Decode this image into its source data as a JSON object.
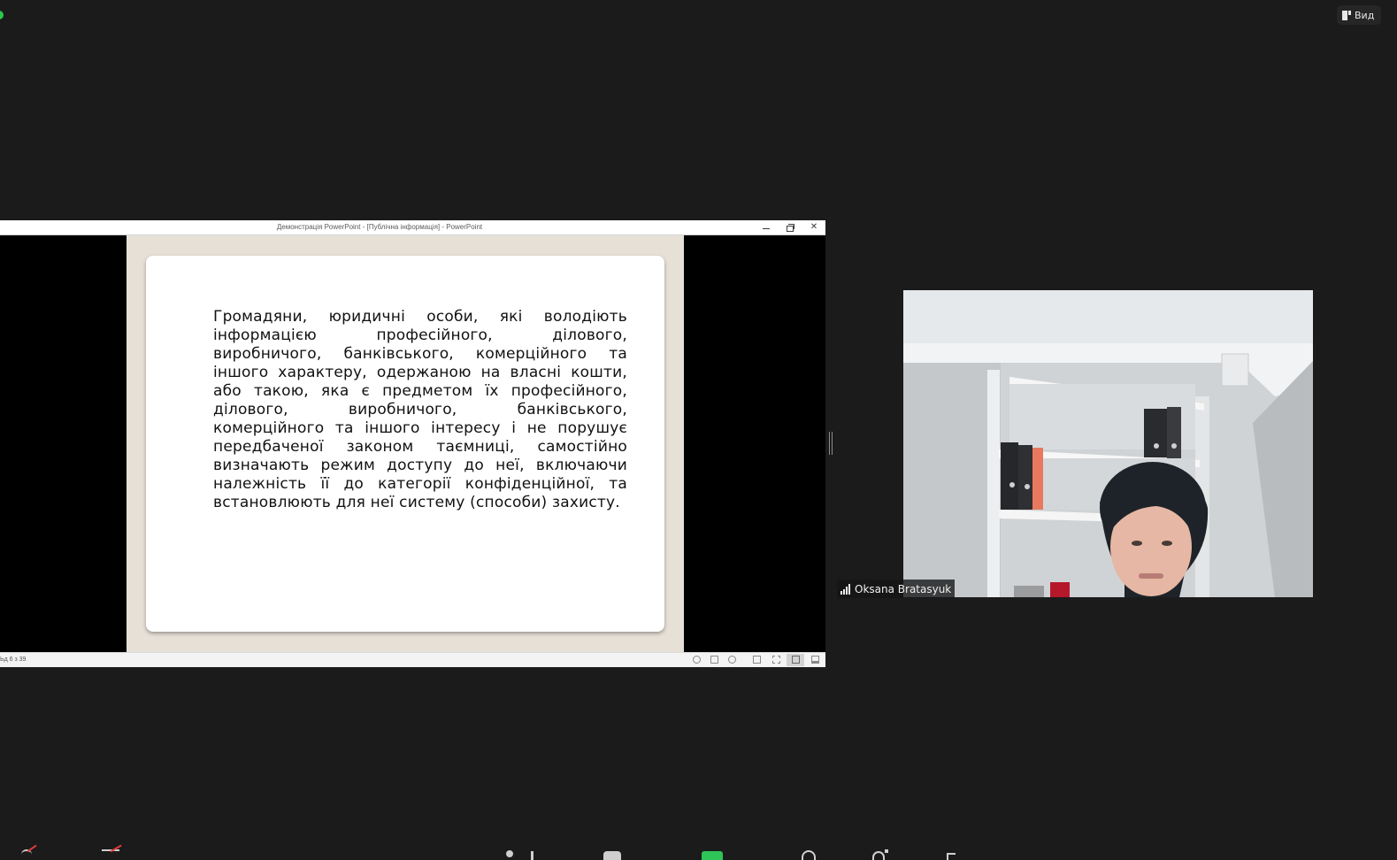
{
  "view_button": {
    "label": "Вид",
    "icon": "view-layout-icon"
  },
  "ppt_window": {
    "title": "Демонстрація PowerPoint - [Публічна інформація] - PowerPoint",
    "controls": {
      "minimize": "minimize-icon",
      "restore": "restore-icon",
      "close": "✕"
    },
    "slide_text": "Громадяни, юридичні особи, які володіють інформацією професійного, ділового, виробничого, банківського, комерційного та іншого характеру, одержаною на власні кошти, або такою, яка є предметом їх професійного, ділового, виробничого, банківського, комерційного та іншого інтересу і не порушує передбаченої законом таємниці, самостійно визначають режим доступу до неї, включаючи належність її до категорії конфіденційної, та встановлюють для неї систему (способи) захисту.",
    "status": {
      "slide_counter": "Ьд 6 з 39"
    }
  },
  "participant": {
    "name": "Oksana Bratasyuk",
    "signal_icon": "signal-bars-icon"
  },
  "colors": {
    "background": "#1b1b1b",
    "slide_frame": "#e7e0d7",
    "share_accent": "#2fc457",
    "mute_red": "#e23b3b"
  }
}
